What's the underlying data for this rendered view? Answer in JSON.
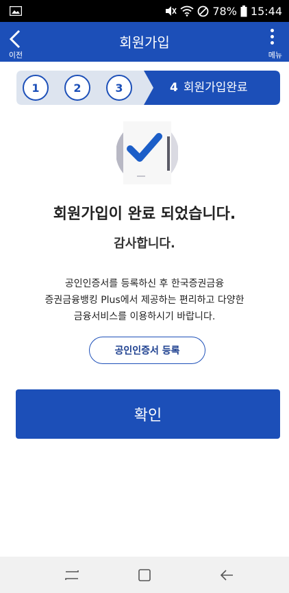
{
  "status_bar": {
    "battery": "78%",
    "time": "15:44"
  },
  "header": {
    "back_label": "이전",
    "title": "회원가입",
    "menu_label": "메뉴"
  },
  "stepper": {
    "steps": [
      "1",
      "2",
      "3"
    ],
    "current_number": "4",
    "current_label": "회원가입완료"
  },
  "content": {
    "title": "회원가입이 완료 되었습니다.",
    "thanks": "감사합니다.",
    "description": [
      "공인인증서를 등록하신 후 한국증권금융",
      "증권금융뱅킹 Plus에서 제공하는 편리하고 다양한",
      "금융서비스를 이용하시기 바랍니다."
    ],
    "register_button": "공인인증서 등록",
    "confirm_button": "확인"
  },
  "colors": {
    "primary": "#1c4fb8",
    "stepper_bg": "#dde4ef"
  }
}
